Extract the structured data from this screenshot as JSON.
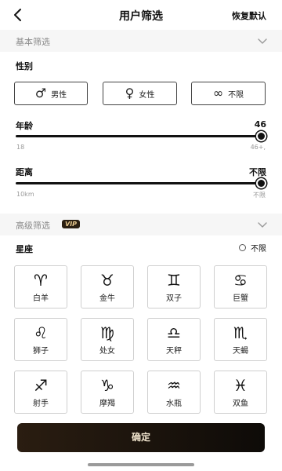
{
  "header": {
    "title": "用户筛选",
    "back_icon": "back-icon",
    "reset_label": "恢复默认"
  },
  "basic": {
    "section_label": "基本筛选",
    "gender": {
      "label": "性别",
      "options": [
        {
          "icon": "male-icon",
          "glyph": "♂",
          "label": "男性"
        },
        {
          "icon": "female-icon",
          "glyph": "♀",
          "label": "女性"
        },
        {
          "icon": "infinity-icon",
          "glyph": "∞",
          "label": "不限"
        }
      ]
    },
    "age": {
      "label": "年龄",
      "value": "46",
      "min_label": "18",
      "max_label": "46+,",
      "level": 1.0
    },
    "distance": {
      "label": "距离",
      "value": "不限",
      "min_label": "10km",
      "max_label": "不限",
      "level": 1.0
    }
  },
  "advanced": {
    "section_label": "高级筛选",
    "vip_badge": "VIP",
    "zodiac": {
      "label": "星座",
      "unlimited_label": "不限",
      "items": [
        {
          "icon": "aries-icon",
          "glyph": "♈︎",
          "label": "白羊"
        },
        {
          "icon": "taurus-icon",
          "glyph": "♉︎",
          "label": "金牛"
        },
        {
          "icon": "gemini-icon",
          "glyph": "♊︎",
          "label": "双子"
        },
        {
          "icon": "cancer-icon",
          "glyph": "♋︎",
          "label": "巨蟹"
        },
        {
          "icon": "leo-icon",
          "glyph": "♌︎",
          "label": "狮子"
        },
        {
          "icon": "virgo-icon",
          "glyph": "♍︎",
          "label": "处女"
        },
        {
          "icon": "libra-icon",
          "glyph": "♎︎",
          "label": "天秤"
        },
        {
          "icon": "scorpio-icon",
          "glyph": "♏︎",
          "label": "天蝎"
        },
        {
          "icon": "sagittarius-icon",
          "glyph": "♐︎",
          "label": "射手"
        },
        {
          "icon": "capricorn-icon",
          "glyph": "♑︎",
          "label": "摩羯"
        },
        {
          "icon": "aquarius-icon",
          "glyph": "♒︎",
          "label": "水瓶"
        },
        {
          "icon": "pisces-icon",
          "glyph": "♓︎",
          "label": "双鱼"
        }
      ]
    }
  },
  "footer": {
    "confirm_label": "确定"
  },
  "colors": {
    "accent": "#111111",
    "button_gradient_start": "#2a1d11",
    "button_text": "#f2e6cf",
    "section_bg": "#f6f6f6"
  }
}
